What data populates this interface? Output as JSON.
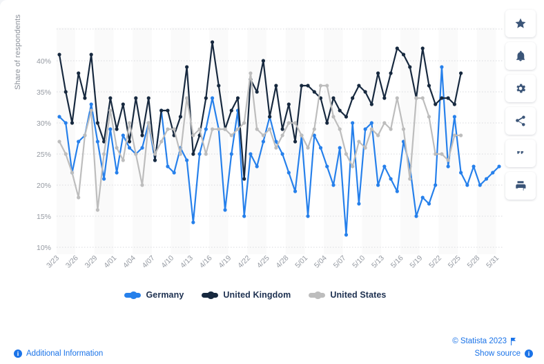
{
  "chart_data": {
    "type": "line",
    "title": "",
    "xlabel": "",
    "ylabel": "Share of respondents",
    "ylim": [
      10,
      43
    ],
    "yticks": [
      10,
      15,
      20,
      25,
      30,
      35,
      40
    ],
    "ytick_labels": [
      "10%",
      "15%",
      "20%",
      "25%",
      "30%",
      "35%",
      "40%"
    ],
    "grid": true,
    "legend_position": "bottom",
    "x": [
      "3/23",
      "3/24",
      "3/25",
      "3/26",
      "3/27",
      "3/28",
      "3/29",
      "3/30",
      "3/31",
      "4/01",
      "4/02",
      "4/03",
      "4/04",
      "4/05",
      "4/06",
      "4/07",
      "4/08",
      "4/09",
      "4/10",
      "4/11",
      "4/12",
      "4/13",
      "4/14",
      "4/15",
      "4/16",
      "4/17",
      "4/18",
      "4/19",
      "4/20",
      "4/21",
      "4/22",
      "4/23",
      "4/24",
      "4/25",
      "4/26",
      "4/27",
      "4/28",
      "4/29",
      "4/30",
      "5/01",
      "5/02",
      "5/03",
      "5/04",
      "5/05",
      "5/06",
      "5/07",
      "5/08",
      "5/09",
      "5/10",
      "5/11",
      "5/12",
      "5/13",
      "5/14",
      "5/15",
      "5/16",
      "5/17",
      "5/18",
      "5/19",
      "5/20",
      "5/21",
      "5/22",
      "5/23",
      "5/24",
      "5/25",
      "5/26",
      "5/27",
      "5/28",
      "5/29",
      "5/30",
      "5/31"
    ],
    "xtick_labels": [
      "3/23",
      "3/26",
      "3/29",
      "4/01",
      "4/04",
      "4/07",
      "4/10",
      "4/13",
      "4/16",
      "4/19",
      "4/22",
      "4/25",
      "4/28",
      "5/01",
      "5/04",
      "5/07",
      "5/10",
      "5/13",
      "5/16",
      "5/19",
      "5/22",
      "5/25",
      "5/28",
      "5/31"
    ],
    "xtick_every": 3,
    "series": [
      {
        "name": "Germany",
        "color": "#2680eb",
        "values": [
          31,
          30,
          22,
          27,
          28,
          33,
          27,
          21,
          29,
          22,
          28,
          26,
          25,
          26,
          30,
          24,
          32,
          23,
          22,
          26,
          24,
          14,
          25,
          29,
          34,
          29,
          16,
          25,
          32,
          15,
          25,
          23,
          27,
          31,
          27,
          25,
          22,
          19,
          28,
          15,
          28,
          26,
          23,
          20,
          26,
          12,
          30,
          17,
          29,
          30,
          20,
          23,
          21,
          19,
          27,
          23,
          15,
          18,
          17,
          20,
          39,
          23,
          31,
          22,
          20,
          23,
          20,
          21,
          22,
          23
        ]
      },
      {
        "name": "United Kingdom",
        "color": "#17293f",
        "values": [
          41,
          35,
          30,
          38,
          34,
          41,
          30,
          27,
          34,
          29,
          33,
          27,
          34,
          28,
          34,
          24,
          32,
          32,
          28,
          31,
          39,
          25,
          28,
          34,
          43,
          36,
          29,
          32,
          34,
          21,
          37,
          35,
          40,
          31,
          36,
          29,
          33,
          27,
          36,
          36,
          35,
          34,
          30,
          34,
          32,
          31,
          34,
          36,
          35,
          33,
          38,
          34,
          38,
          42,
          41,
          39,
          34,
          42,
          36,
          33,
          34,
          34,
          33,
          38
        ]
      },
      {
        "name": "United States",
        "color": "#bdbdbd",
        "values": [
          27,
          25,
          22,
          18,
          28,
          32,
          16,
          25,
          32,
          26,
          24,
          30,
          25,
          20,
          30,
          25,
          27,
          29,
          29,
          25,
          34,
          28,
          29,
          25,
          29,
          29,
          29,
          28,
          29,
          30,
          38,
          29,
          28,
          29,
          26,
          28,
          30,
          30,
          28,
          26,
          29,
          36,
          36,
          31,
          29,
          25,
          23,
          27,
          26,
          29,
          28,
          30,
          29,
          34,
          29,
          21,
          34,
          34,
          31,
          25,
          25,
          24,
          28,
          28
        ]
      }
    ]
  },
  "legend": {
    "items": [
      {
        "label": "Germany",
        "color": "#2680eb"
      },
      {
        "label": "United Kingdom",
        "color": "#17293f"
      },
      {
        "label": "United States",
        "color": "#bdbdbd"
      }
    ]
  },
  "toolbar": {
    "buttons": [
      {
        "icon": "star-icon",
        "name": "favorite-button"
      },
      {
        "icon": "bell-icon",
        "name": "alert-button"
      },
      {
        "icon": "gear-icon",
        "name": "settings-button"
      },
      {
        "icon": "share-icon",
        "name": "share-button"
      },
      {
        "icon": "quote-icon",
        "name": "cite-button"
      },
      {
        "icon": "print-icon",
        "name": "print-button"
      }
    ]
  },
  "footer": {
    "copyright": "© Statista 2023",
    "additional_information": "Additional Information",
    "show_source": "Show source",
    "info_glyph": "i"
  },
  "colors": {
    "link": "#1a73e8",
    "grid": "#d8dade",
    "band": "#fafafa",
    "axis_text": "#9499a1"
  }
}
